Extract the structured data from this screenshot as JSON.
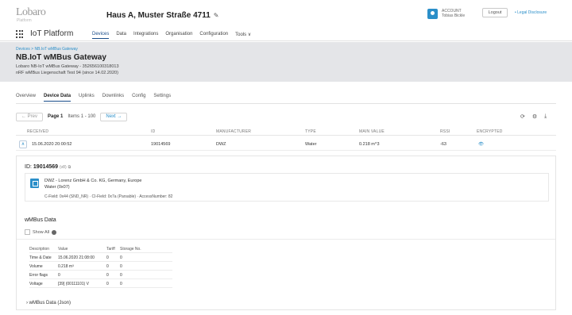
{
  "header": {
    "logo": "Lobaro",
    "logo_sub": "Platform",
    "house_title": "Haus A, Muster Straße 4711",
    "edit_icon": "✎",
    "app_name": "IoT Platform",
    "nav": [
      "Devices",
      "Data",
      "Integrations",
      "Organisation",
      "Configuration",
      "Tools ∨"
    ],
    "account_label": "ACCOUNT",
    "account_name": "Tobias Bickle",
    "logout": "Logout",
    "legal": "• Legal Disclosure"
  },
  "banner": {
    "breadcrumb": "Devices > NB.IoT wMBus Gateway",
    "title": "NB.IoT wMBus Gateway",
    "line1": "Lobaro NB-IoT wMBus Gateway - 352656100318013",
    "line2": "nRF wMBus Liegenschaft Test 94 (since 14.02.2020)"
  },
  "subtabs": [
    "Overview",
    "Device Data",
    "Uplinks",
    "Downlinks",
    "Config",
    "Settings"
  ],
  "pager": {
    "prev": "← Prev",
    "page": "Page 1",
    "items": "Items 1 - 100",
    "next": "Next →"
  },
  "table": {
    "columns": [
      "RECEIVED",
      "ID",
      "MANUFACTURER",
      "TYPE",
      "MAIN VALUE",
      "RSSI",
      "ENCRYPTED"
    ],
    "row": {
      "received": "15.06.2020 20:00:52",
      "id": "19014569",
      "manufacturer": "DWZ",
      "type": "Water",
      "main_value": "0.218 m^3",
      "rssi": "-63",
      "encrypted": "👁"
    }
  },
  "detail": {
    "id_label": "ID:",
    "id_value": "19014569",
    "id_sub": "(v8)",
    "manufacturer_line": "DWZ - Lorenz GmbH & Co. KG, Germany, Europe",
    "medium_line": "Water (0x07)",
    "field_line": "C-Field: 0x44 (SND_NR) · CI-Field: 0x7a (Parsable) · AccessNumber: 82",
    "wmbus_title": "wMBus Data",
    "show_all": "Show All",
    "wtable": {
      "headers": [
        "Description",
        "Value",
        "Tariff",
        "Storage No."
      ],
      "rows": [
        [
          "Time & Date",
          "15.06.2020 21:08:00",
          "0",
          "0"
        ],
        [
          "Volume",
          "0.218 m³",
          "0",
          "0"
        ],
        [
          "Error flags",
          "0",
          "0",
          "0"
        ],
        [
          "Voltage",
          "[39] (00111101) V",
          "0",
          "0"
        ]
      ]
    },
    "json_label": "wMBus Data (Json)"
  }
}
